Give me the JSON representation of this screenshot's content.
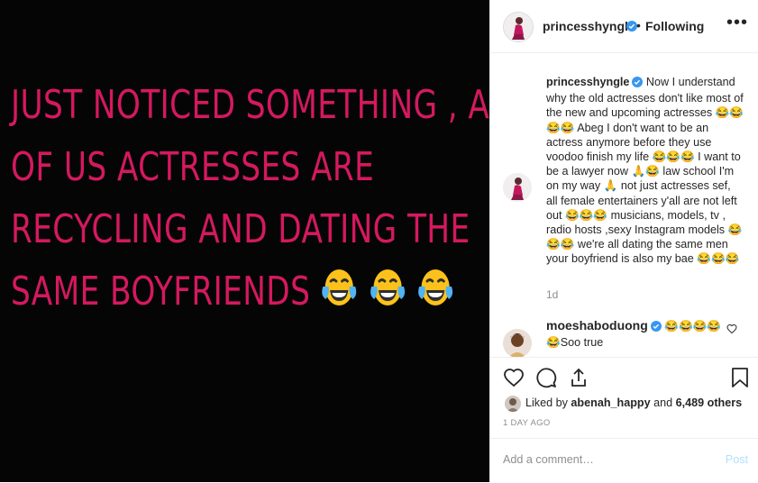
{
  "post": {
    "lines": [
      "JUST NOTICED SOMETHING , ALL",
      "OF US ACTRESSES ARE",
      "RECYCLING AND DATING THE",
      "SAME BOYFRIENDS"
    ],
    "text_color": "#d4195f",
    "background": "#050505"
  },
  "header": {
    "username": "princesshyngle",
    "separator": "•",
    "follow_status": "Following",
    "more_icon": "more-icon"
  },
  "caption": {
    "username": "princesshyngle",
    "seg1": "Now I understand why the old actresses don't like most of the new and upcoming actresses",
    "seg2": "Abeg I don't want to be an actress anymore before they use voodoo finish my life",
    "seg3": "I want to be a lawyer now",
    "seg4": "law school I'm on my way",
    "seg5": "not just actresses sef, all female entertainers y'all are not left out",
    "seg6": "musicians, models, tv , radio hosts ,sexy Instagram models",
    "seg7": "we're all dating the same men your boyfriend is also my bae",
    "time": "1d"
  },
  "comment": {
    "username": "moeshaboduong",
    "text": "Soo true"
  },
  "likes": {
    "prefix": "Liked by",
    "user": "abenah_happy",
    "middle": "and",
    "count": "6,489 others"
  },
  "time_ago": "1 DAY AGO",
  "add_comment": {
    "placeholder": "Add a comment…",
    "post_label": "Post"
  },
  "colors": {
    "verified": "#3897f0",
    "post_button": "#b2dffc",
    "secondary_text": "#8e8e8e"
  }
}
